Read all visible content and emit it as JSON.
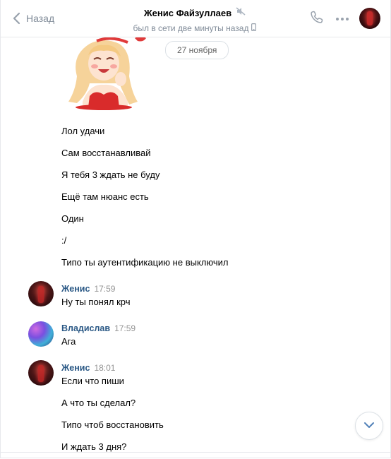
{
  "header": {
    "back_label": "Назад",
    "title": "Женис Файзуллаев",
    "status": "был в сети две минуты назад"
  },
  "date_divider": "27 ноября",
  "messages_group1": [
    "Лол удачи",
    "Сам восстанавливай",
    "Я тебя 3 ждать не буду",
    "Ещё там нюанс есть",
    "Один",
    ":/",
    "Типо ты аутентификацию не выключил"
  ],
  "block_zhenis_1": {
    "author": "Женис",
    "time": "17:59",
    "text": "Ну ты понял крч"
  },
  "block_vlad": {
    "author": "Владислав",
    "time": "17:59",
    "text": "Ага"
  },
  "block_zhenis_2": {
    "author": "Женис",
    "time": "18:01",
    "messages": [
      "Если что пиши",
      "А что ты сделал?",
      "Типо чтоб восстановить",
      "И ждать 3 дня?"
    ]
  },
  "icons": {
    "back": "chevron-left-icon",
    "mute": "muted-speaker-icon",
    "mobile": "mobile-phone-icon",
    "call": "phone-icon",
    "more": "more-dots-icon",
    "scroll": "chevron-down-icon"
  },
  "colors": {
    "author_name": "#2a5885",
    "secondary_text": "#818c99",
    "time": "#939393"
  }
}
